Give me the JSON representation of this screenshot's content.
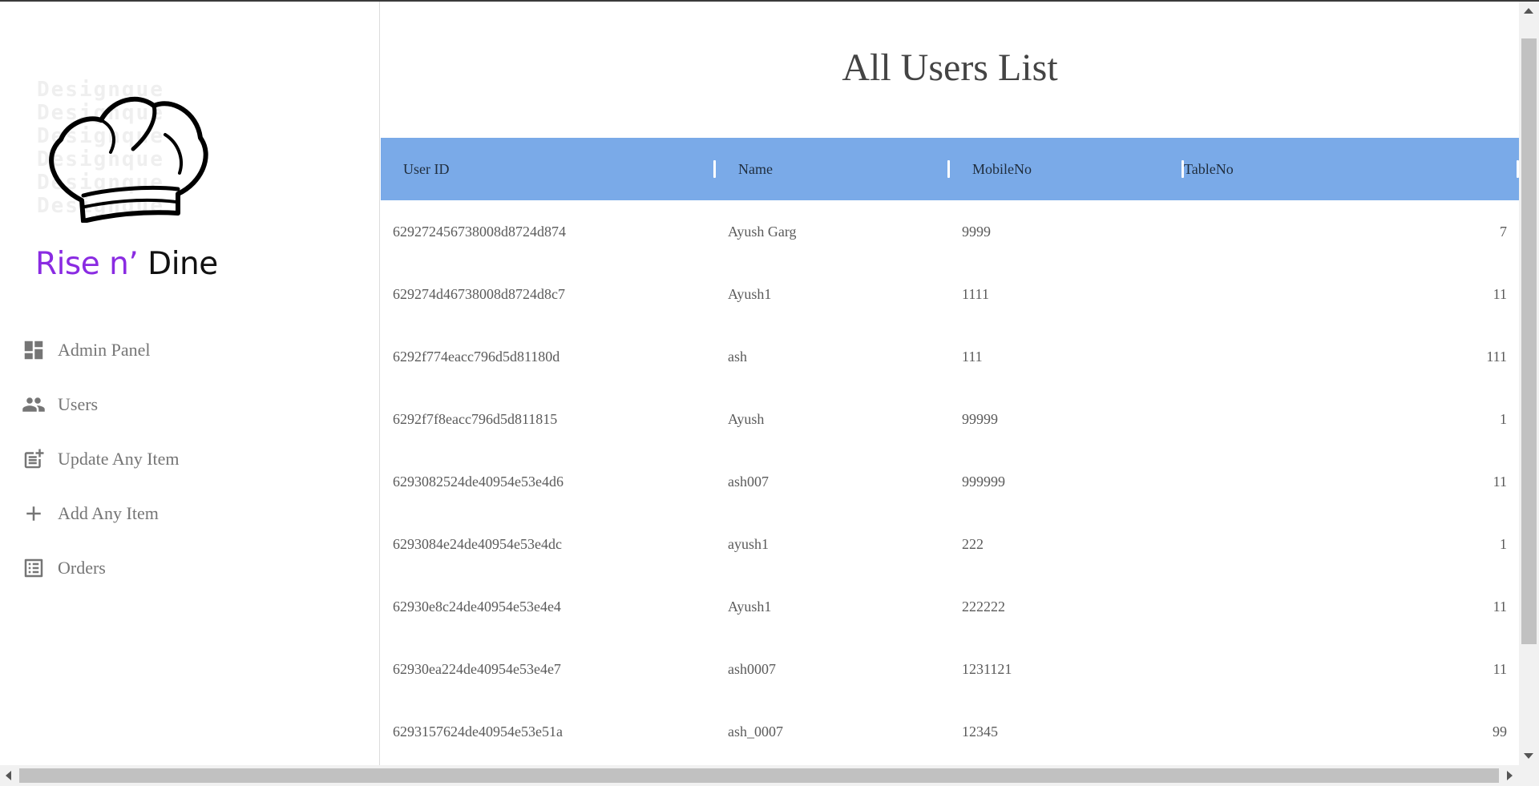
{
  "brand": {
    "part1": "Rise n’",
    "part2": "Dine",
    "colors": {
      "part1": "#8a2be2",
      "part2": "#111111"
    },
    "logo_icon": "chef-hat-icon"
  },
  "sidebar": {
    "items": [
      {
        "label": "Admin Panel",
        "icon": "dashboard-icon"
      },
      {
        "label": "Users",
        "icon": "people-icon"
      },
      {
        "label": "Update Any Item",
        "icon": "post-add-icon"
      },
      {
        "label": "Add Any Item",
        "icon": "plus-icon"
      },
      {
        "label": "Orders",
        "icon": "list-alt-icon"
      }
    ]
  },
  "main": {
    "title": "All Users List",
    "table": {
      "header_color": "#7aaae8",
      "columns": [
        "User ID",
        "Name",
        "MobileNo",
        "TableNo"
      ],
      "rows": [
        {
          "id": "629272456738008d8724d874",
          "name": "Ayush Garg",
          "mobile": "9999",
          "table": "7"
        },
        {
          "id": "629274d46738008d8724d8c7",
          "name": "Ayush1",
          "mobile": "1111",
          "table": "11"
        },
        {
          "id": "6292f774eacc796d5d81180d",
          "name": "ash",
          "mobile": "111",
          "table": "111"
        },
        {
          "id": "6292f7f8eacc796d5d811815",
          "name": "Ayush",
          "mobile": "99999",
          "table": "1"
        },
        {
          "id": "6293082524de40954e53e4d6",
          "name": "ash007",
          "mobile": "999999",
          "table": "11"
        },
        {
          "id": "6293084e24de40954e53e4dc",
          "name": "ayush1",
          "mobile": "222",
          "table": "1"
        },
        {
          "id": "62930e8c24de40954e53e4e4",
          "name": "Ayush1",
          "mobile": "222222",
          "table": "11"
        },
        {
          "id": "62930ea224de40954e53e4e7",
          "name": "ash0007",
          "mobile": "1231121",
          "table": "11"
        },
        {
          "id": "6293157624de40954e53e51a",
          "name": "ash_0007",
          "mobile": "12345",
          "table": "99"
        }
      ]
    }
  }
}
